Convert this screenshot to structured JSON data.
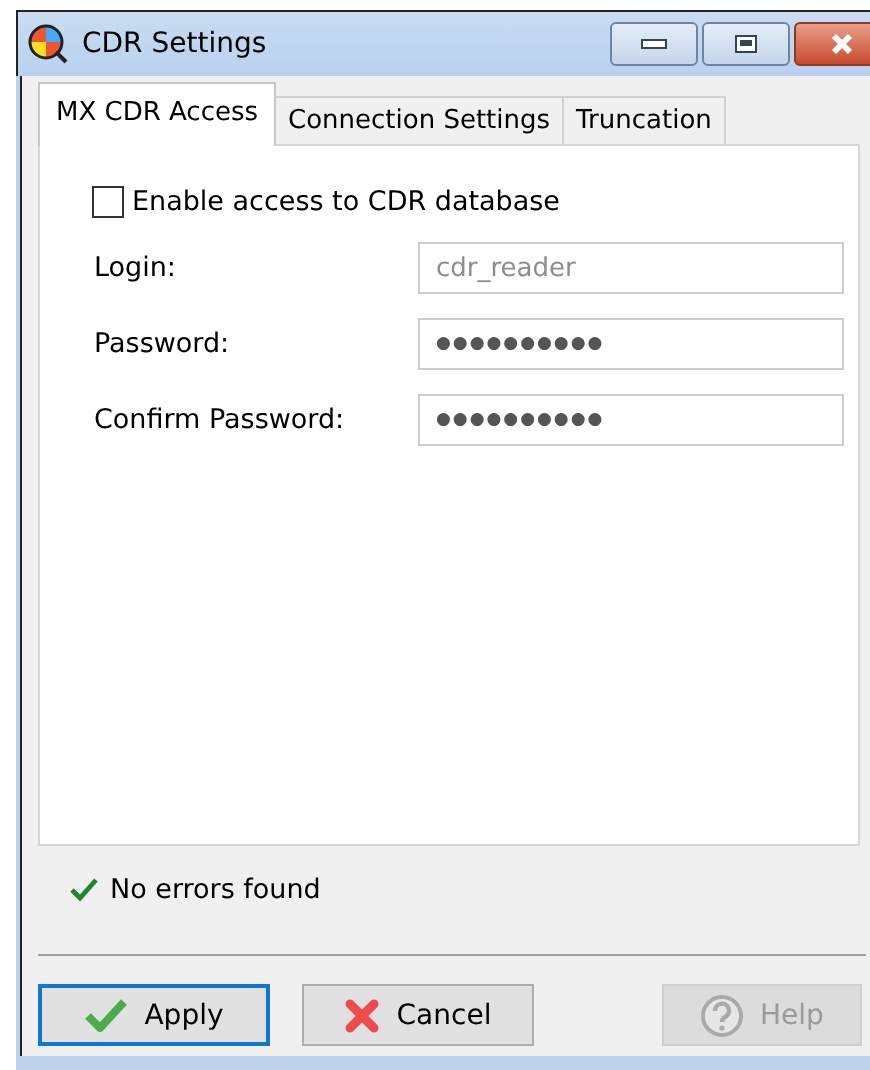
{
  "window": {
    "title": "CDR Settings"
  },
  "tabs": [
    {
      "label": "MX CDR Access",
      "selected": true
    },
    {
      "label": "Connection Settings",
      "selected": false
    },
    {
      "label": "Truncation",
      "selected": false
    }
  ],
  "enable_checkbox": {
    "label": "Enable access to CDR database",
    "checked": false
  },
  "fields": [
    {
      "label": "Login:",
      "value": "cdr_reader",
      "disabled": true
    },
    {
      "label": "Password:",
      "value": "●●●●●●●●●●",
      "disabled": false
    },
    {
      "label": "Confirm Password:",
      "value": "●●●●●●●●●●",
      "disabled": false
    }
  ],
  "status": {
    "text": "No errors found",
    "kind": "ok"
  },
  "buttons": [
    {
      "label": "Apply",
      "kind": "apply",
      "default": true,
      "disabled": false
    },
    {
      "label": "Cancel",
      "kind": "cancel",
      "default": false,
      "disabled": false
    },
    {
      "label": "Help",
      "kind": "help",
      "default": false,
      "disabled": true
    }
  ]
}
